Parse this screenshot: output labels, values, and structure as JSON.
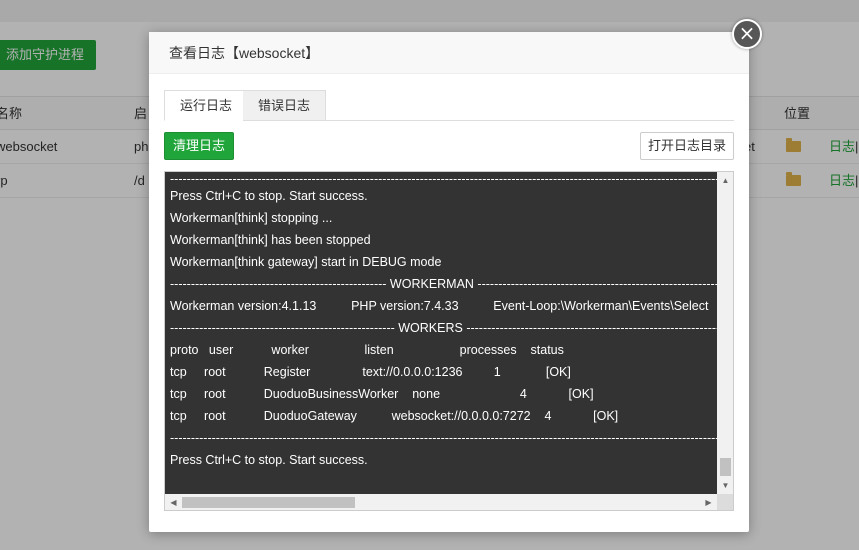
{
  "background": {
    "add_button_label": "添加守护进程",
    "table": {
      "headers": [
        "名称",
        "启",
        "位置"
      ],
      "rows": [
        {
          "name": "websocket",
          "path": "ph",
          "extra": "et",
          "action": "日志",
          "sep": "|"
        },
        {
          "name": "rp",
          "path": "/d",
          "extra": "",
          "action": "日志",
          "sep": "|"
        }
      ]
    }
  },
  "modal": {
    "title": "查看日志【websocket】",
    "close_icon": "×",
    "tabs": [
      {
        "label": "运行日志",
        "active": true
      },
      {
        "label": "错误日志",
        "active": false
      }
    ],
    "clear_button": "清理日志",
    "open_dir_button": "打开日志目录",
    "log_lines": [
      "----------------------------------------------------------------------------------------------------------------------------------------------------------------",
      "Press Ctrl+C to stop. Start success.",
      "Workerman[think] stopping ...",
      "Workerman[think] has been stopped",
      "Workerman[think gateway] start in DEBUG mode",
      "---------------------------------------------------- WORKERMAN ---------------------------------------------------------------",
      "Workerman version:4.1.13          PHP version:7.4.33          Event-Loop:\\Workerman\\Events\\Select",
      "------------------------------------------------------ WORKERS ----------------------------------------------------------------",
      "proto   user           worker                listen                   processes    status",
      "tcp     root           Register               text://0.0.0.0:1236         1             [OK]",
      "tcp     root           DuoduoBusinessWorker    none                       4            [OK]",
      "tcp     root           DuoduoGateway          websocket://0.0.0.0:7272    4            [OK]",
      "----------------------------------------------------------------------------------------------------------------------------------------------------------------",
      "Press Ctrl+C to stop. Start success."
    ]
  },
  "colors": {
    "brand_green": "#20a53a",
    "console_bg": "#333333",
    "folder": "#e0b44a"
  },
  "icons": {
    "close": "close-icon",
    "folder": "folder-icon",
    "scroll_up": "chevron-up-icon",
    "scroll_down": "chevron-down-icon",
    "scroll_left": "chevron-left-icon",
    "scroll_right": "chevron-right-icon"
  }
}
